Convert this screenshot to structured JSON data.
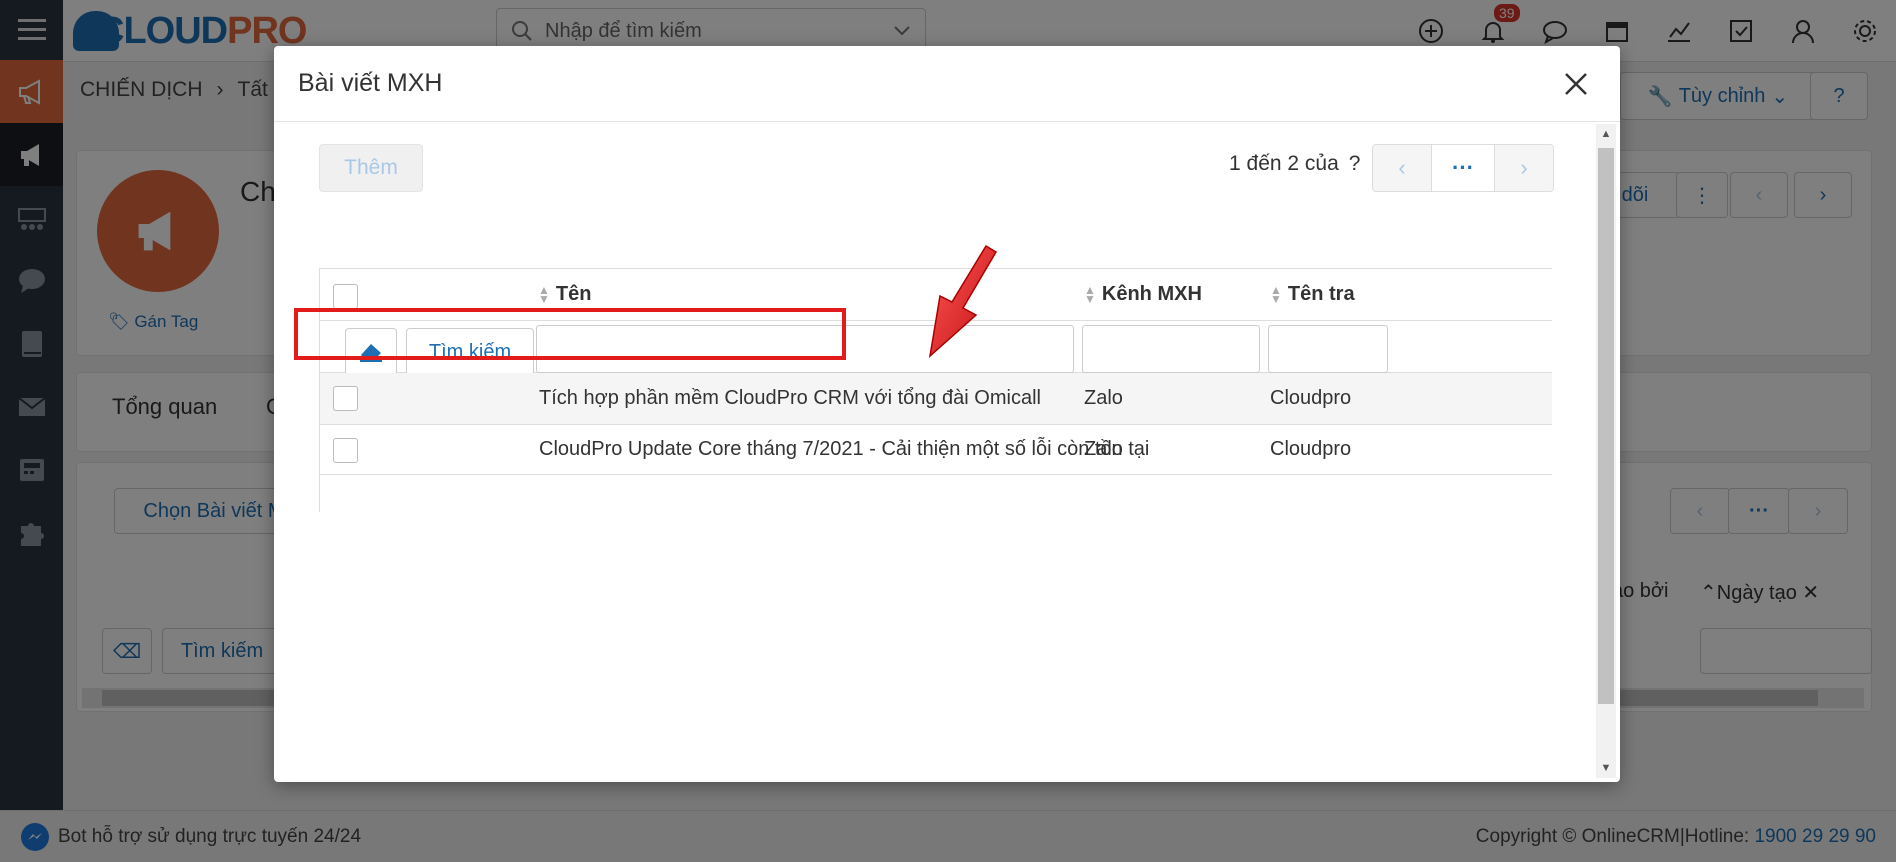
{
  "app": {
    "logo_text_a": "CLOUD",
    "logo_text_b": "PRO",
    "search_placeholder": "Nhập để tìm kiếm",
    "notification_count": "39",
    "breadcrumb": {
      "section": "CHIẾN DỊCH",
      "current": "Tất c"
    },
    "customize_label": "Tùy chỉnh",
    "record_title_partial": "Ch",
    "tag_label": "Gán Tag",
    "follow_label": "dõi",
    "tab_overview": "Tổng quan",
    "tab_second_partial": "C",
    "select_post_label": "Chọn Bài viết M",
    "col_created_by": "ạo bởi",
    "col_created_date": "Ngày tạo",
    "bg_search_label": "Tìm kiếm"
  },
  "footer": {
    "bot_text": "Bot hỗ trợ sử dụng trực tuyến 24/24",
    "copyright": "Copyright © OnlineCRM|Hotline: ",
    "hotline": "1900 29 29 90"
  },
  "modal": {
    "title": "Bài viết MXH",
    "add_label": "Thêm",
    "pager_text": "1 đến 2 của",
    "pager_unknown": "?",
    "columns": [
      "Tên",
      "Kênh MXH",
      "Tên tra"
    ],
    "search_label": "Tìm kiếm",
    "rows": [
      {
        "name": "Tích hợp phần mềm CloudPro CRM với tổng đài Omicall",
        "channel": "Zalo",
        "page": "Cloudpro"
      },
      {
        "name": "CloudPro Update Core tháng 7/2021 - Cải thiện một số lỗi còn tồn tại",
        "channel": "Zalo",
        "page": "Cloudpro"
      }
    ]
  },
  "colors": {
    "brand_blue": "#1f6fb5",
    "brand_orange": "#e0683e",
    "highlight_red": "#e21b1b"
  }
}
